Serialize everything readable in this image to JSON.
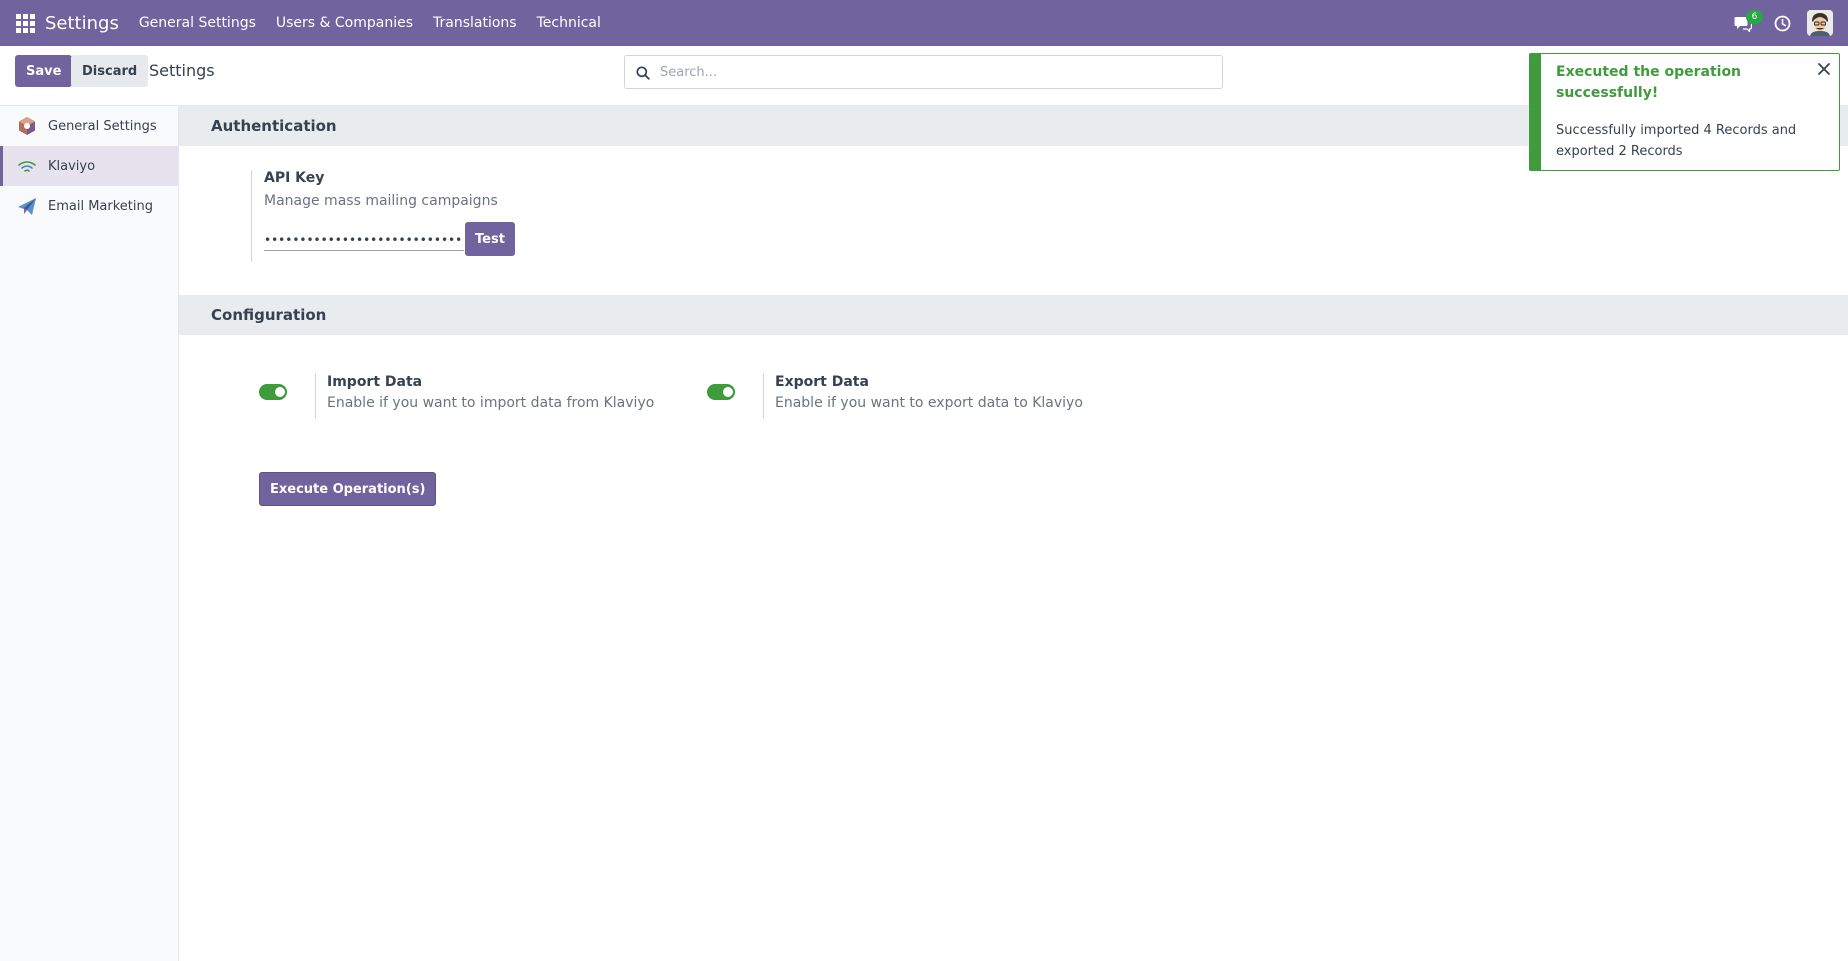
{
  "navbar": {
    "brand": "Settings",
    "menu": [
      "General Settings",
      "Users & Companies",
      "Translations",
      "Technical"
    ],
    "chat_badge": "6",
    "accent_color": "#71639e"
  },
  "control_panel": {
    "save_label": "Save",
    "discard_label": "Discard",
    "title": "Settings",
    "search_placeholder": "Search..."
  },
  "sidebar": {
    "items": [
      {
        "label": "General Settings",
        "icon": "settings-hexagon-icon",
        "active": false
      },
      {
        "label": "Klaviyo",
        "icon": "klaviyo-wave-icon",
        "active": true
      },
      {
        "label": "Email Marketing",
        "icon": "paper-plane-icon",
        "active": false
      }
    ]
  },
  "authentication": {
    "header": "Authentication",
    "api_key_label": "API Key",
    "api_key_help": "Manage mass mailing campaigns",
    "api_key_value": "••••••••••••••••••••••••••••••••••••••••••••",
    "test_label": "Test"
  },
  "configuration": {
    "header": "Configuration",
    "import": {
      "title": "Import Data",
      "help": "Enable if you want to import data from Klaviyo",
      "enabled": true
    },
    "export": {
      "title": "Export Data",
      "help": "Enable if you want to export data to Klaviyo",
      "enabled": true
    },
    "execute_label": "Execute Operation(s)"
  },
  "notification": {
    "title": "Executed the operation successfully!",
    "message": "Successfully imported 4 Records and exported 2 Records",
    "color": "#3f9b3b"
  }
}
